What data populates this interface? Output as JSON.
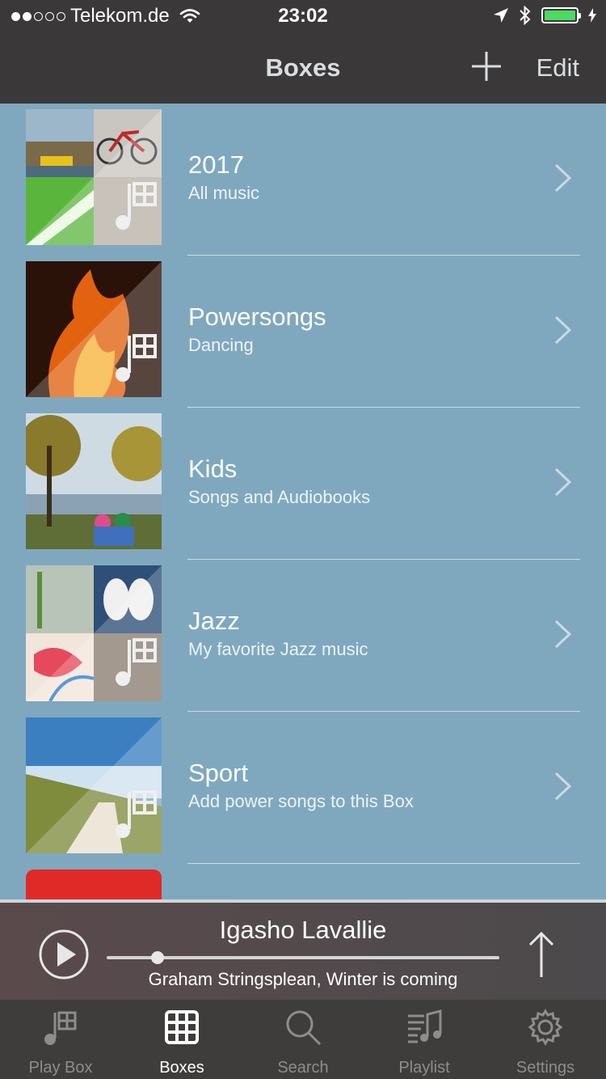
{
  "status_bar": {
    "carrier": "Telekom.de",
    "time": "23:02",
    "signal_bars": 2,
    "icons": [
      "wifi-icon",
      "location-arrow-icon",
      "bluetooth-icon",
      "battery-icon"
    ],
    "battery_color": "#4cd964"
  },
  "nav": {
    "title": "Boxes",
    "add_icon": "plus-icon",
    "edit_label": "Edit"
  },
  "boxes": [
    {
      "title": "2017",
      "subtitle": "All music"
    },
    {
      "title": "Powersongs",
      "subtitle": "Dancing"
    },
    {
      "title": "Kids",
      "subtitle": "Songs and Audiobooks"
    },
    {
      "title": "Jazz",
      "subtitle": "My favorite Jazz music"
    },
    {
      "title": "Sport",
      "subtitle": "Add power songs to this Box"
    }
  ],
  "player": {
    "title": "Igasho Lavallie",
    "subtitle": "Graham Stringsplean, Winter is coming",
    "progress": 0.13
  },
  "tabs": [
    {
      "label": "Play Box",
      "icon": "play-box-icon",
      "active": false
    },
    {
      "label": "Boxes",
      "icon": "boxes-icon",
      "active": true
    },
    {
      "label": "Search",
      "icon": "search-icon",
      "active": false
    },
    {
      "label": "Playlist",
      "icon": "playlist-icon",
      "active": false
    },
    {
      "label": "Settings",
      "icon": "gear-icon",
      "active": false
    }
  ],
  "colors": {
    "nav_bg": "#3a3838",
    "list_bg": "#7fa8bf",
    "tabbar_bg": "#3f3c3c",
    "tab_inactive": "#8d8d8d",
    "tab_active": "#ffffff"
  }
}
